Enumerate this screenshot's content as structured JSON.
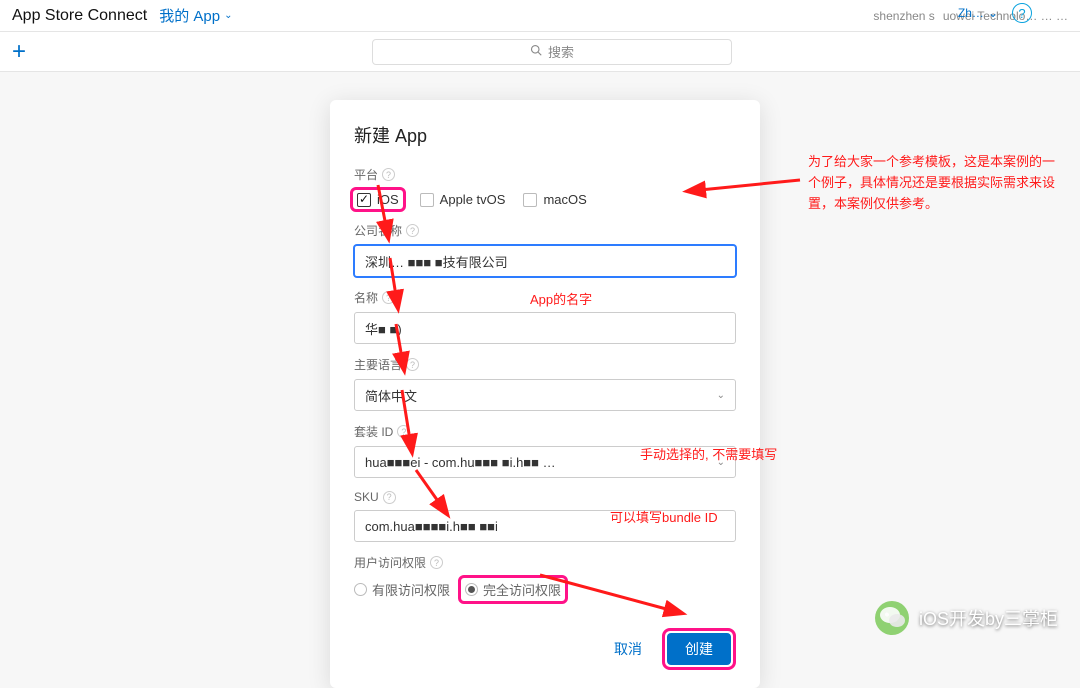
{
  "header": {
    "title": "App Store Connect",
    "myapp_link": "我的 App",
    "org_left": "shenzhen s",
    "org_right": "uowei Technolo… … …",
    "language_menu": "Zh…"
  },
  "searchbar": {
    "placeholder": "搜索"
  },
  "modal": {
    "title": "新建 App",
    "platform_label": "平台",
    "platforms": {
      "ios": "iOS",
      "tvos": "Apple tvOS",
      "macos": "macOS"
    },
    "company_label": "公司名称",
    "company_value": "深圳… ■■■ ■技有限公司",
    "name_label": "名称",
    "name_value": "华■ ■)",
    "lang_label": "主要语言",
    "lang_value": "简体中文",
    "bundle_label": "套装 ID",
    "bundle_value": "hua■■■ei - com.hu■■■ ■i.h■■ …",
    "sku_label": "SKU",
    "sku_value": "com.hua■■■■i.h■■ ■■i",
    "access_label": "用户访问权限",
    "access_limited": "有限访问权限",
    "access_full": "完全访问权限",
    "cancel": "取消",
    "create": "创建"
  },
  "annotations": {
    "top_right": "为了给大家一个参考模板，这是本案例的一个例子，具体情况还是要根据实际需求来设置，本案例仅供参考。",
    "app_name": "App的名字",
    "bundle_note": "手动选择的, 不需要填写",
    "sku_note": "可以填写bundle ID"
  },
  "watermark": "iOS开发by三掌柜"
}
